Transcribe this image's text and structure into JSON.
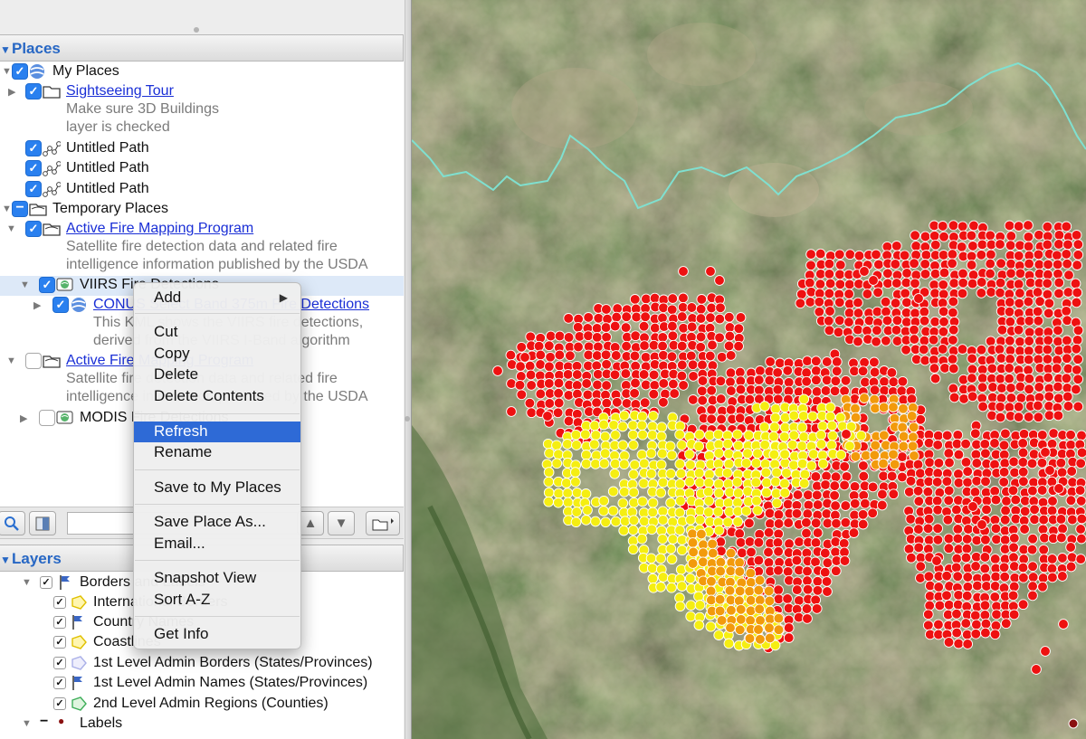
{
  "places": {
    "title": "Places",
    "rows": {
      "my_places": "My Places",
      "sightseeing": "Sightseeing Tour",
      "sightseeing_desc_1": "Make sure 3D Buildings",
      "sightseeing_desc_2": "layer is checked",
      "path_1": "Untitled Path",
      "path_2": "Untitled Path",
      "path_3": "Untitled Path",
      "temporary": "Temporary Places",
      "afmp": "Active Fire Mapping Program",
      "afmp_desc_1": "Satellite fire detection data and related fire",
      "afmp_desc_2": "intelligence information published by the USDA",
      "viirs": "VIIRS Fire Detections",
      "conus": "CONUS Select Band 375m Fire Detections",
      "conus_desc_1": "This KML shows the VIIRS fire detections,",
      "conus_desc_2": "derived from the VIIRS I-Band algorithm",
      "afmp2": "Active Fire Mapping Program",
      "afmp2_desc_1": "Satellite fire detection data and related fire",
      "afmp2_desc_2": "intelligence information published by the USDA",
      "modis": "MODIS Fire Detections"
    }
  },
  "layers": {
    "title": "Layers",
    "rows": {
      "borders": "Borders and Labels",
      "intl": "International Borders",
      "country": "Country Names",
      "coast": "Coastlines",
      "admin1_borders": "1st Level Admin Borders (States/Provinces)",
      "admin1_names": "1st Level Admin Names (States/Provinces)",
      "admin2": "2nd Level Admin Regions (Counties)",
      "labels": "Labels"
    }
  },
  "context_menu": {
    "add": "Add",
    "cut": "Cut",
    "copy": "Copy",
    "delete": "Delete",
    "delete_contents": "Delete Contents",
    "refresh": "Refresh",
    "rename": "Rename",
    "save_to_my_places": "Save to My Places",
    "save_place_as": "Save Place As...",
    "email": "Email...",
    "snapshot_view": "Snapshot View",
    "sort_az": "Sort A-Z",
    "get_info": "Get Info",
    "highlighted": "Refresh"
  },
  "icons": {
    "expand": "triangle-right-icon",
    "collapse": "triangle-down-icon",
    "folder": "folder-icon",
    "globe": "globe-icon",
    "path": "path-icon",
    "network_link": "network-link-icon",
    "flag": "flag-icon",
    "polygon": "polygon-icon",
    "search": "magnifier-icon",
    "tour": "tour-icon",
    "up": "up-arrow-icon",
    "down": "down-arrow-icon",
    "new_folder": "new-folder-icon"
  },
  "colors": {
    "accent": "#2e6ad6",
    "section_title": "#2767c4",
    "link": "#1a2fd6",
    "checkbox": "#2a80ef",
    "fire_high": "#ee1111",
    "fire_mid": "#f29a0c",
    "fire_low": "#f5ee12",
    "boundary_line": "#7fe0d0"
  }
}
